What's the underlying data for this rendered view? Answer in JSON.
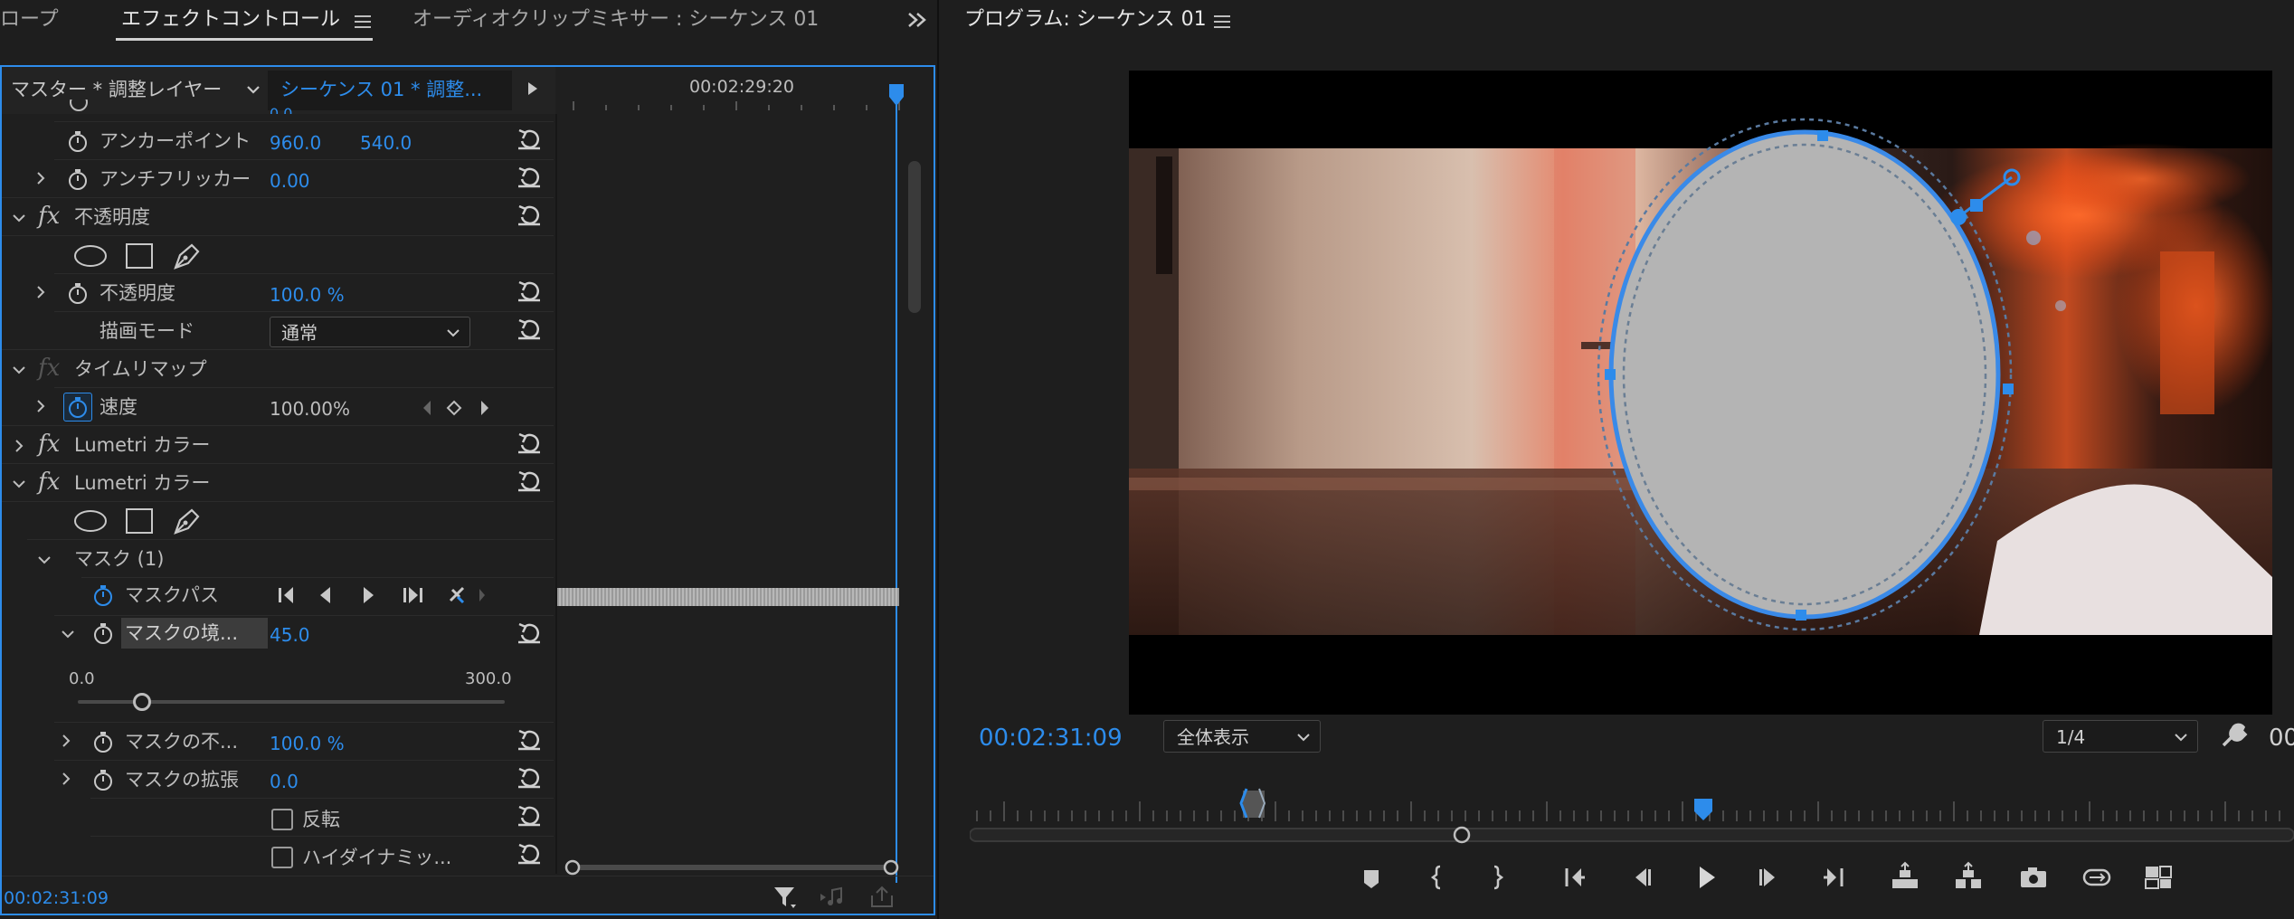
{
  "tabs": {
    "left_cut": "ロープ",
    "effect_controls": "エフェクトコントロール",
    "audio_mixer": "オーディオクリップミキサー : シーケンス 01",
    "program": "プログラム: シーケンス 01"
  },
  "ec": {
    "master_label": "マスター * 調整レイヤー",
    "sequence_label": "シーケンス 01 * 調整...",
    "timecode_ruler": "00:02:29:20",
    "cut_value": "0.0",
    "anchor_label": "アンカーポイント",
    "anchor_x": "960.0",
    "anchor_y": "540.0",
    "antiflicker_label": "アンチフリッカー",
    "antiflicker_value": "0.00",
    "opacity_section": "不透明度",
    "opacity_label": "不透明度",
    "opacity_value": "100.0 %",
    "blend_label": "描画モード",
    "blend_value": "通常",
    "time_remap": "タイムリマップ",
    "speed_label": "速度",
    "speed_value": "100.00%",
    "lumetri1": "Lumetri カラー",
    "lumetri2": "Lumetri カラー",
    "mask_title": "マスク (1)",
    "mask_path": "マスクパス",
    "mask_feather_label": "マスクの境...",
    "mask_feather_value": "45.0",
    "slider_min": "0.0",
    "slider_max": "300.0",
    "slider_fraction": 0.15,
    "mask_opacity_label": "マスクの不...",
    "mask_opacity_value": "100.0 %",
    "mask_expansion_label": "マスクの拡張",
    "mask_expansion_value": "0.0",
    "invert_label": "反転",
    "hdr_label": "ハイダイナミッ...",
    "footer_timecode": "00:02:31:09"
  },
  "program": {
    "timecode": "00:02:31:09",
    "zoom": "全体表示",
    "resolution": "1/4",
    "right_cut": "00"
  },
  "colors": {
    "accent": "#2d8ceb",
    "panel_bg": "#1e1e1e",
    "text": "#bdbdbd"
  },
  "icons": [
    "menu-icon",
    "stopwatch-icon",
    "reset-icon",
    "ellipse-mask-icon",
    "rectangle-mask-icon",
    "pen-mask-icon",
    "wrench-icon",
    "filter-icon",
    "play-icon",
    "step-back-icon",
    "step-forward-icon",
    "camera-icon",
    "marker-icon"
  ]
}
